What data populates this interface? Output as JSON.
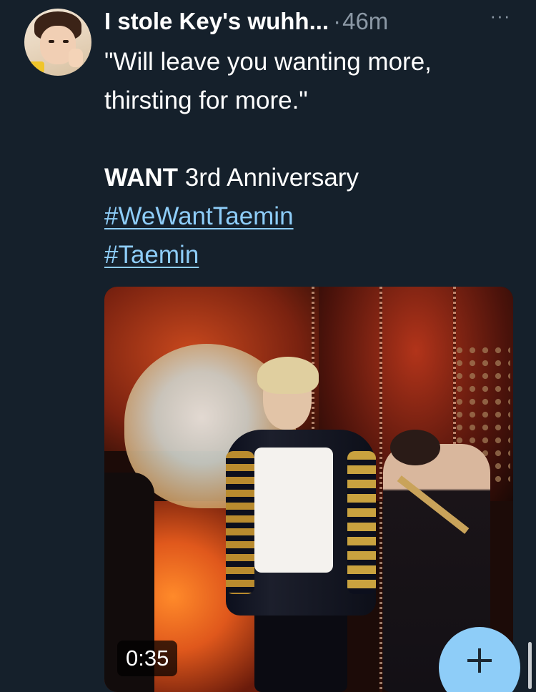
{
  "tweet": {
    "author": {
      "display_name": "I stole Key's wuhh...",
      "avatar_icon": "user-avatar"
    },
    "separator": "·",
    "timestamp": "46m",
    "more_label": "···",
    "text": {
      "quote_line1": "\"Will leave you wanting more,",
      "quote_line2": "thirsting for more.\"",
      "emphasis": "WANT",
      "anniversary": " 3rd Anniversary",
      "hashtags": [
        "#WeWantTaemin",
        "#Taemin"
      ]
    },
    "media": {
      "type": "video",
      "duration": "0:35"
    }
  },
  "compose_button": {
    "icon": "plus-icon",
    "color": "#8ecdf8"
  },
  "colors": {
    "background": "#15202b",
    "secondary_text": "#8b98a5",
    "link": "#8ecdf8"
  }
}
